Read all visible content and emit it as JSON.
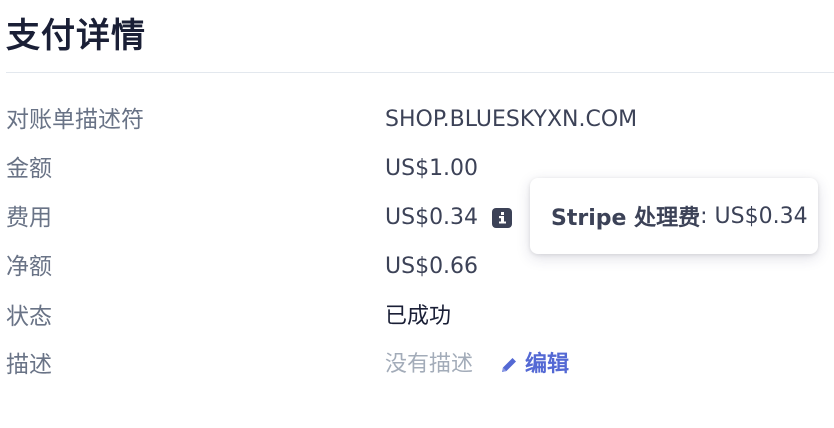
{
  "page": {
    "title": "支付详情"
  },
  "details": {
    "statement_descriptor": {
      "label": "对账单描述符",
      "value": "SHOP.BLUESKYXN.COM"
    },
    "amount": {
      "label": "金额",
      "value": "US$1.00"
    },
    "fee": {
      "label": "费用",
      "value": "US$0.34",
      "icon": "info-icon"
    },
    "net": {
      "label": "净额",
      "value": "US$0.66"
    },
    "status": {
      "label": "状态",
      "value": "已成功"
    },
    "description": {
      "label": "描述",
      "value": "没有描述",
      "edit_label": "编辑",
      "edit_icon": "pencil-icon"
    }
  },
  "tooltip": {
    "key": "Stripe 处理费",
    "separator": ":",
    "value": "US$0.34"
  },
  "colors": {
    "link": "#5469d4",
    "muted": "#a3acb9",
    "label": "#697386",
    "text": "#3c4257"
  }
}
